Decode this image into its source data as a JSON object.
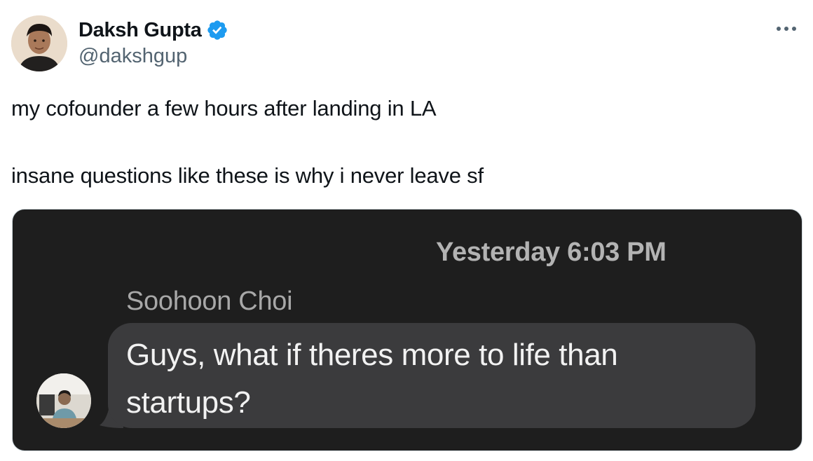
{
  "author": {
    "display_name": "Daksh Gupta",
    "handle": "@dakshgup",
    "verified": true
  },
  "icons": {
    "verified": "verified-badge-icon",
    "more": "more-options-icon"
  },
  "tweet": {
    "text_lines": [
      "my cofounder a few hours after landing in LA",
      "insane questions like these is why i never leave sf"
    ]
  },
  "media": {
    "timestamp": "Yesterday 6:03 PM",
    "sender": "Soohoon Choi",
    "message_lines": [
      "Guys, what if theres more to life than",
      "startups?"
    ]
  },
  "colors": {
    "verified_blue": "#1d9bf0",
    "text_primary": "#0f1419",
    "text_secondary": "#536471",
    "chat_background": "#1e1e1e",
    "bubble": "#3b3b3d"
  }
}
